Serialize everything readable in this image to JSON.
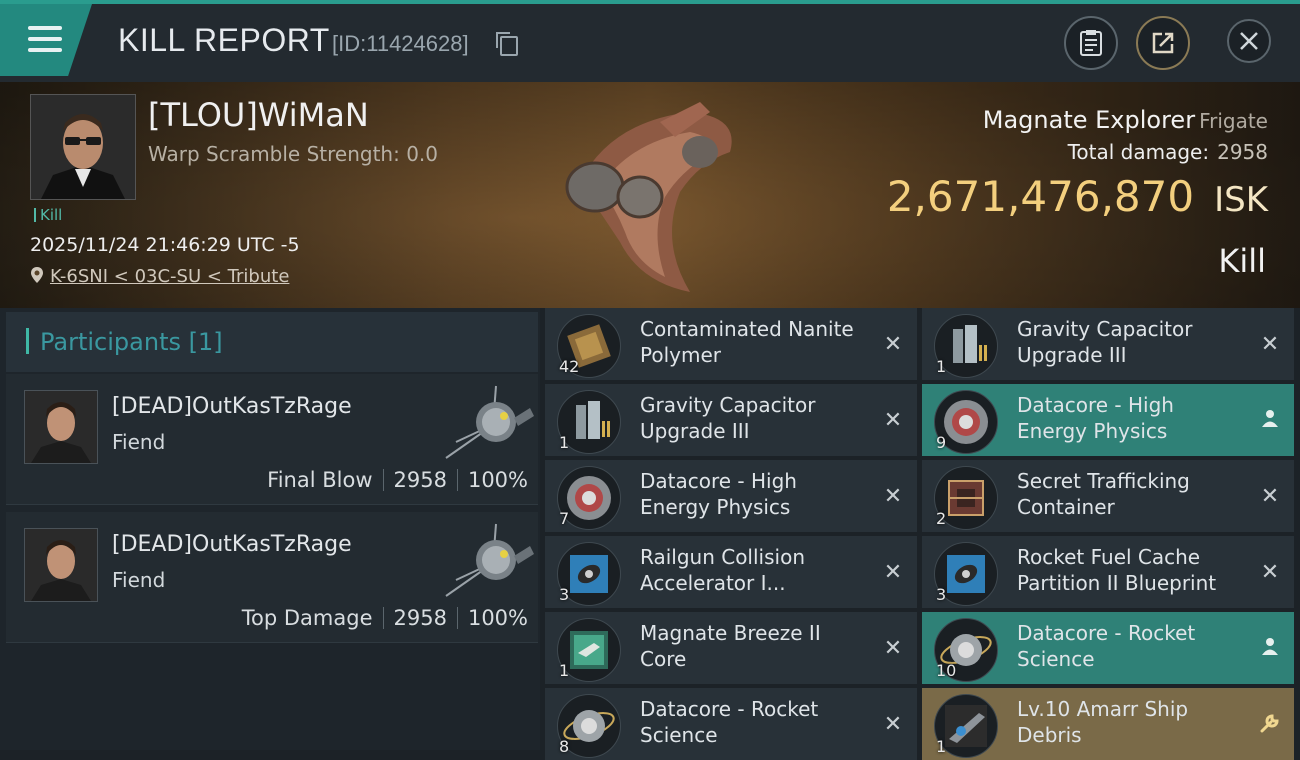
{
  "header": {
    "title": "KILL REPORT",
    "report_id": "[ID:11424628]"
  },
  "victim": {
    "name": "[TLOU]WiMaN",
    "warp_scramble": "Warp Scramble Strength: 0.0",
    "tag": "Kill",
    "timestamp": "2025/11/24 21:46:29 UTC -5",
    "location": "K-6SNI < 03C-SU < Tribute"
  },
  "ship": {
    "name": "Magnate Explorer",
    "class": "Frigate",
    "total_damage_label": "Total damage:",
    "total_damage": "2958",
    "isk_value": "2,671,476,870",
    "isk_unit": "ISK",
    "result": "Kill"
  },
  "participants": {
    "title": "Participants",
    "count": "[1]",
    "rows": [
      {
        "name": "[DEAD]OutKasTzRage",
        "ship": "Fiend",
        "role": "Final Blow",
        "damage": "2958",
        "percent": "100%"
      },
      {
        "name": "[DEAD]OutKasTzRage",
        "ship": "Fiend",
        "role": "Top Damage",
        "damage": "2958",
        "percent": "100%"
      }
    ]
  },
  "items": {
    "left": [
      {
        "qty": "42",
        "name": "Contaminated Nanite Polymer",
        "mark": "✕"
      },
      {
        "qty": "1",
        "name": "Gravity Capacitor Upgrade III",
        "mark": "✕"
      },
      {
        "qty": "7",
        "name": "Datacore - High Energy Physics",
        "mark": "✕"
      },
      {
        "qty": "3",
        "name": "Railgun Collision Accelerator I...",
        "mark": "✕"
      },
      {
        "qty": "1",
        "name": "Magnate Breeze II Core",
        "mark": "✕"
      },
      {
        "qty": "8",
        "name": "Datacore - Rocket Science",
        "mark": "✕"
      }
    ],
    "right": [
      {
        "qty": "1",
        "name": "Gravity Capacitor Upgrade III",
        "mark": "✕"
      },
      {
        "qty": "9",
        "name": "Datacore - High Energy Physics",
        "mark": "person"
      },
      {
        "qty": "2",
        "name": "Secret Trafficking Container",
        "mark": "✕"
      },
      {
        "qty": "3",
        "name": "Rocket Fuel Cache Partition II Blueprint",
        "mark": "✕"
      },
      {
        "qty": "10",
        "name": "Datacore - Rocket Science",
        "mark": "person"
      },
      {
        "qty": "1",
        "name": "Lv.10 Amarr Ship Debris",
        "mark": "wrench"
      }
    ]
  },
  "colors": {
    "accent_teal": "#2a9c8e",
    "isk_gold": "#f3cf7e",
    "dropped_teal": "#2f8177",
    "salvage_gold": "#7a6a48"
  }
}
